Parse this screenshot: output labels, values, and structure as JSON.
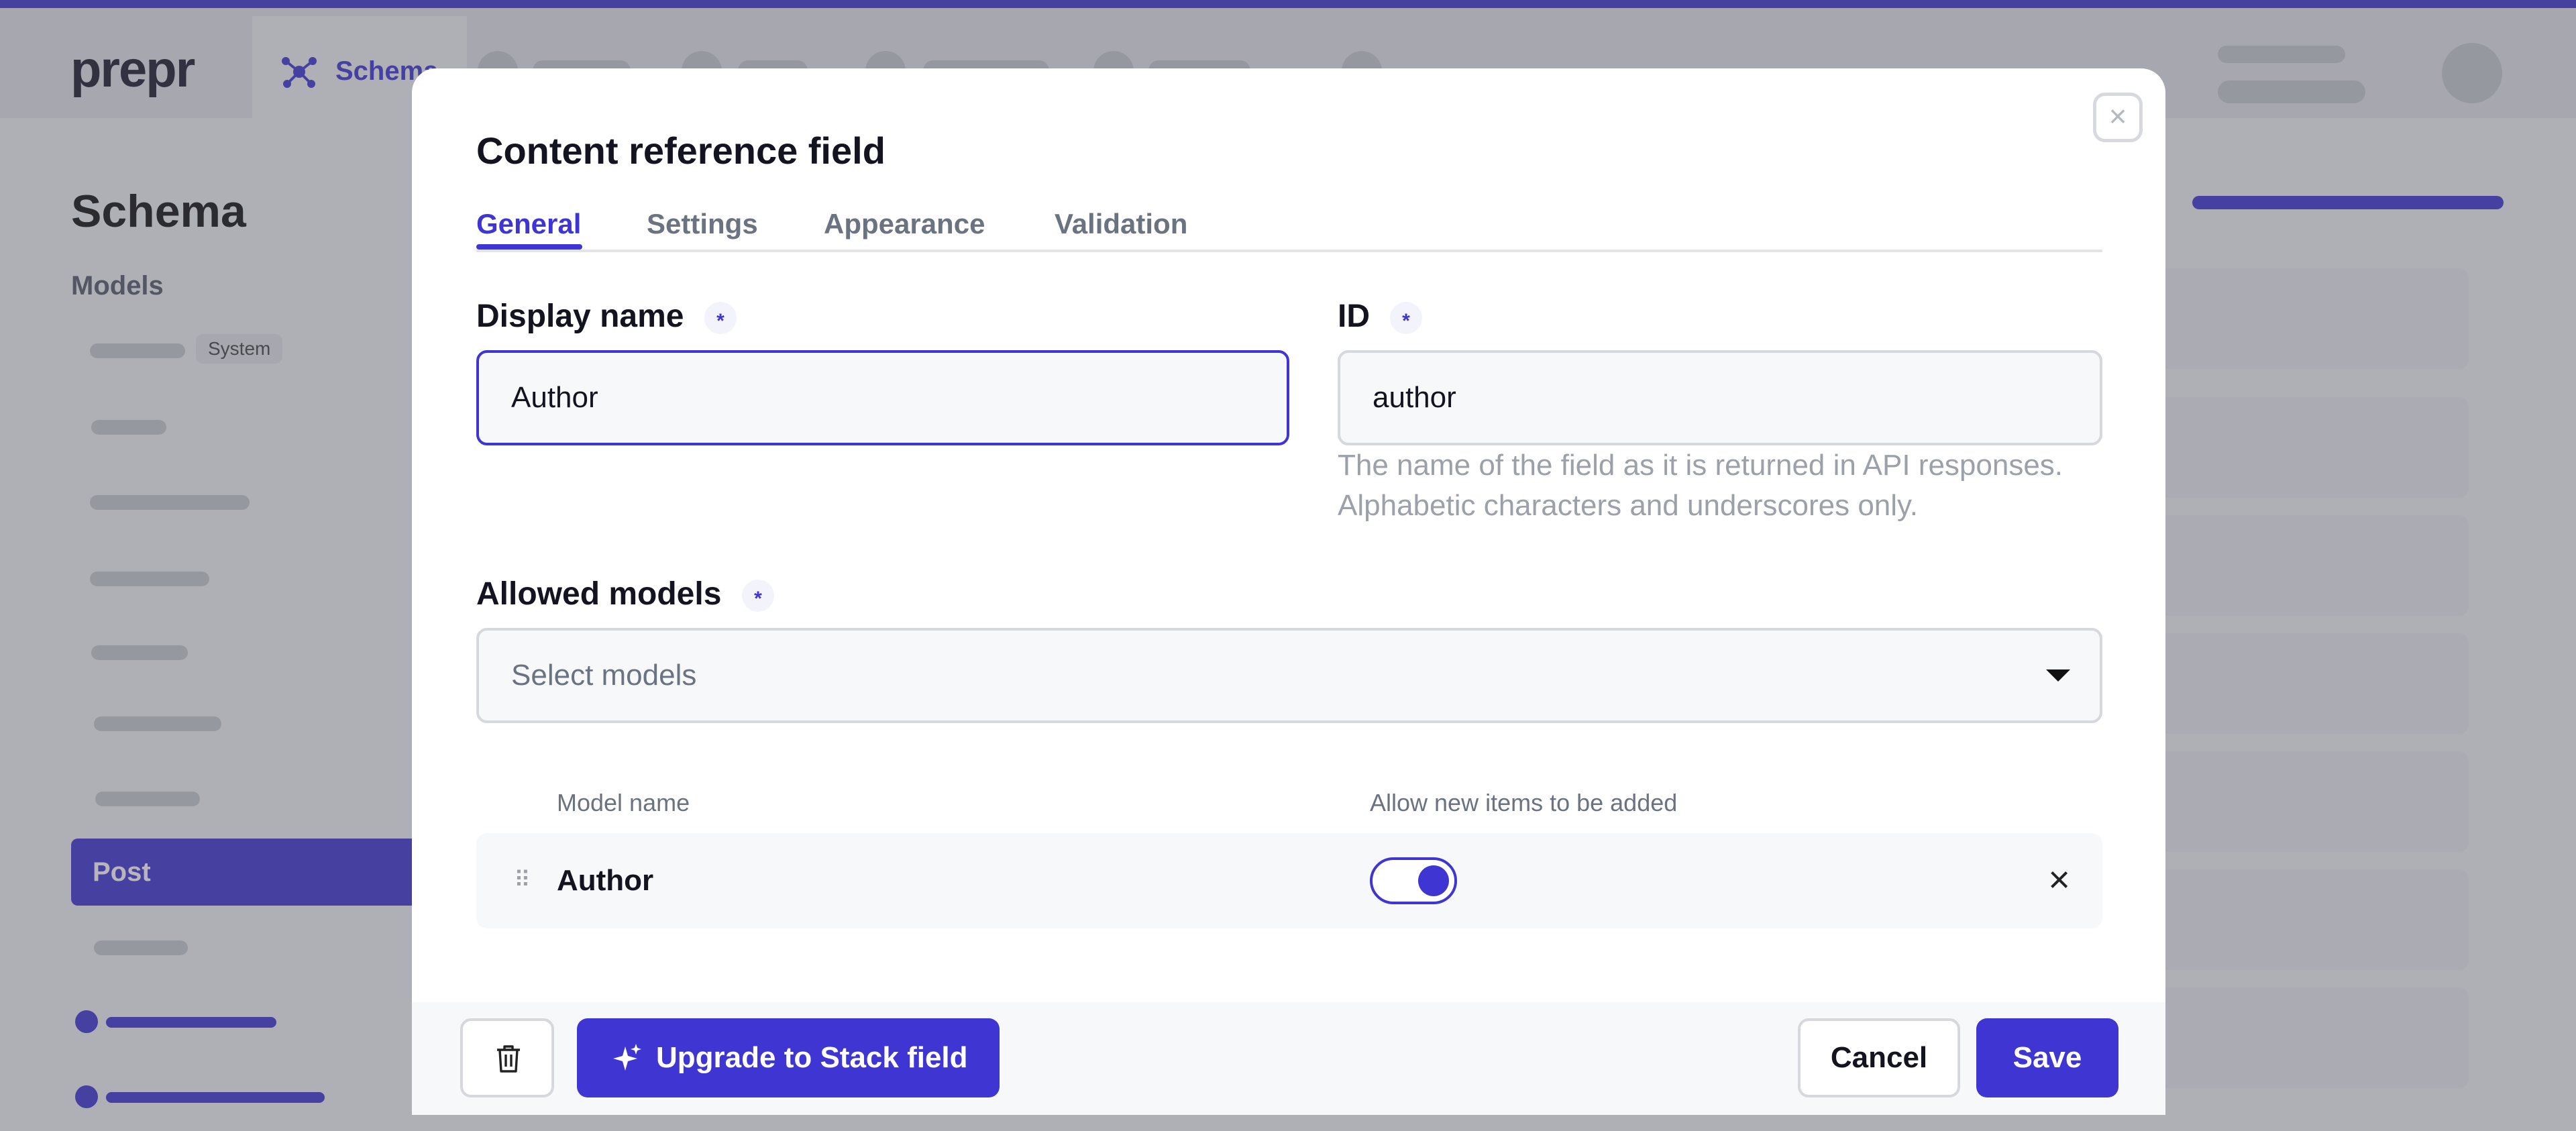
{
  "app": {
    "logo": "prepr",
    "nav_active": "Schema",
    "accent": "#3f35d3"
  },
  "sidebar": {
    "title": "Schema",
    "section": "Models",
    "system_badge": "System",
    "active_item": "Post"
  },
  "modal": {
    "title": "Content reference field",
    "tabs": [
      "General",
      "Settings",
      "Appearance",
      "Validation"
    ],
    "active_tab": "General",
    "display_name": {
      "label": "Display name",
      "required": "*",
      "value": "Author"
    },
    "id_field": {
      "label": "ID",
      "required": "*",
      "value": "author",
      "hint_line1": "The name of the field as it is returned in API responses.",
      "hint_line2": "Alphabetic characters and underscores only."
    },
    "allowed_models": {
      "label": "Allowed models",
      "required": "*",
      "placeholder": "Select models"
    },
    "table": {
      "col_model": "Model name",
      "col_allow": "Allow new items to be added",
      "rows": [
        {
          "name": "Author",
          "allow_new": true
        }
      ]
    },
    "footer": {
      "upgrade": "Upgrade to Stack field",
      "cancel": "Cancel",
      "save": "Save"
    }
  },
  "icons": {
    "close": "close-icon",
    "trash": "trash-icon",
    "sparkle": "sparkle-icon",
    "caret": "caret-down-icon",
    "drag": "drag-handle-icon",
    "remove": "remove-icon",
    "schema": "schema-icon"
  }
}
